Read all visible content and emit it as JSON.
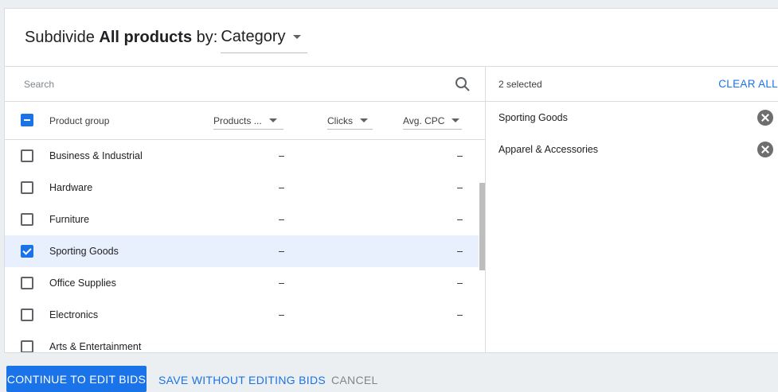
{
  "header": {
    "prefix": "Subdivide",
    "target": "All products",
    "by_label": "by:",
    "dimension": "Category"
  },
  "search": {
    "placeholder": "Search"
  },
  "table": {
    "columns": {
      "product_group": "Product group",
      "products": "Products ...",
      "clicks": "Clicks",
      "avg_cpc": "Avg. CPC"
    },
    "rows": [
      {
        "name": "Business & Industrial",
        "products": "–",
        "avg_cpc": "–",
        "checked": false
      },
      {
        "name": "Hardware",
        "products": "–",
        "avg_cpc": "–",
        "checked": false
      },
      {
        "name": "Furniture",
        "products": "–",
        "avg_cpc": "–",
        "checked": false
      },
      {
        "name": "Sporting Goods",
        "products": "–",
        "avg_cpc": "–",
        "checked": true
      },
      {
        "name": "Office Supplies",
        "products": "–",
        "avg_cpc": "–",
        "checked": false
      },
      {
        "name": "Electronics",
        "products": "–",
        "avg_cpc": "–",
        "checked": false
      },
      {
        "name": "Arts & Entertainment",
        "products": "",
        "avg_cpc": "",
        "checked": false
      }
    ]
  },
  "selection": {
    "count_label": "2 selected",
    "clear_all": "CLEAR ALL",
    "items": [
      {
        "label": "Sporting Goods"
      },
      {
        "label": "Apparel & Accessories"
      }
    ]
  },
  "footer": {
    "continue": "CONTINUE TO EDIT BIDS",
    "save": "SAVE WITHOUT EDITING BIDS",
    "cancel": "CANCEL"
  },
  "colors": {
    "accent": "#1a73e8",
    "selected_row": "#e8f0fe"
  }
}
